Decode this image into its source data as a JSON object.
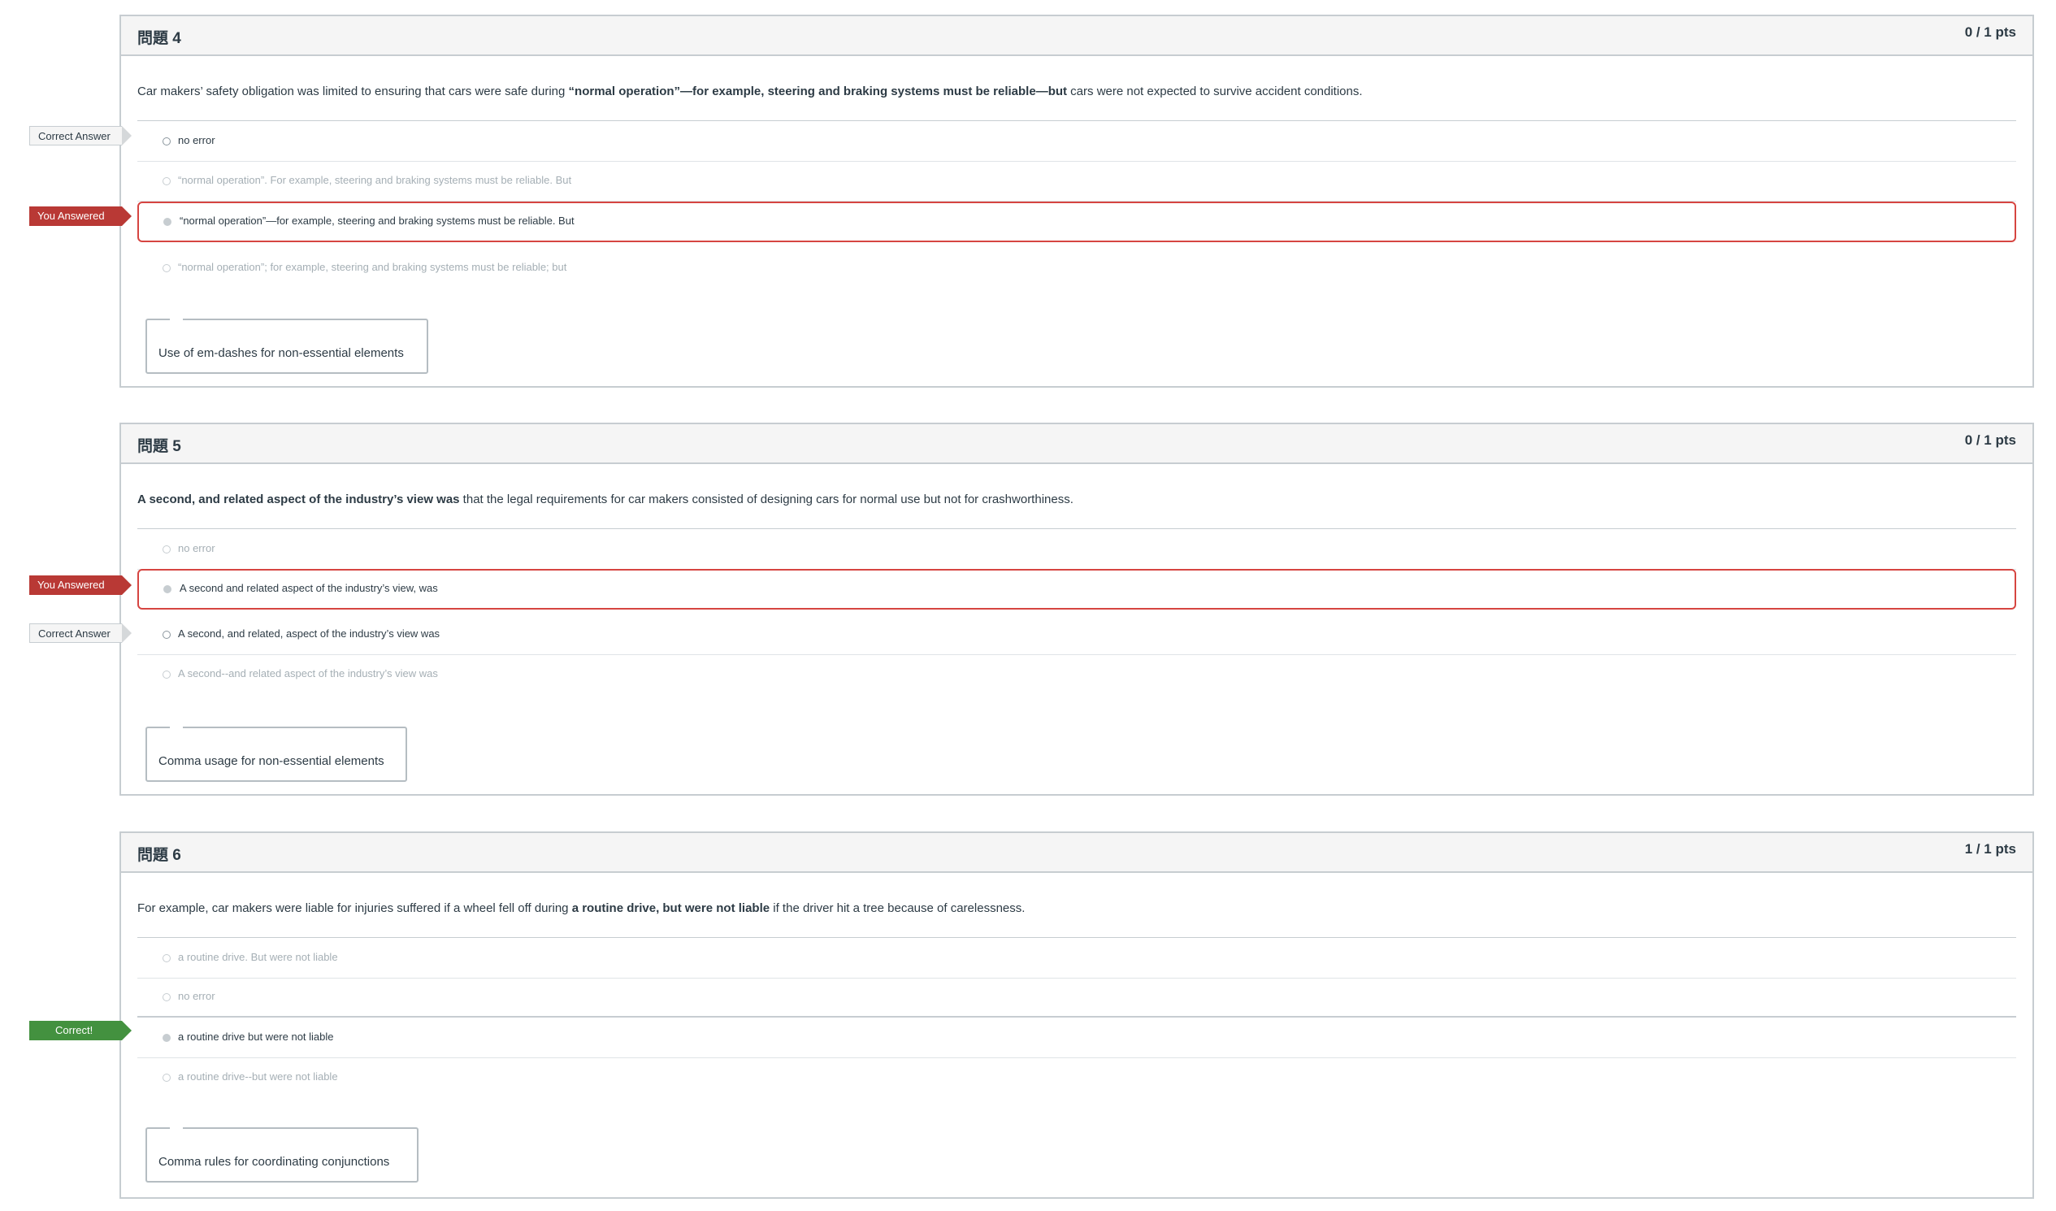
{
  "questions": [
    {
      "title": "問題 4",
      "points": "0 / 1 pts",
      "text_before": "Car makers’ safety obligation was limited to ensuring that cars were safe during ",
      "text_bold": "“normal operation”—for example, steering and braking systems must be reliable—but",
      "text_after": " cars were not expected to survive accident conditions.",
      "answers": [
        {
          "label": "no error",
          "state": "correct"
        },
        {
          "label": "“normal operation”. For example, steering and braking systems must be reliable. But",
          "state": "faded"
        },
        {
          "label": "“normal operation”—for example, steering and braking systems must be reliable. But",
          "state": "selected"
        },
        {
          "label": "“normal operation”; for example, steering and braking systems must be reliable; but",
          "state": "faded"
        }
      ],
      "comment": "Use of em-dashes for non-essential elements"
    },
    {
      "title": "問題 5",
      "points": "0 / 1 pts",
      "text_before": "",
      "text_bold": "A second, and related aspect of the industry’s view was",
      "text_after": " that the legal requirements for car makers consisted of designing cars for normal use but not for crashworthiness.",
      "answers": [
        {
          "label": "no error",
          "state": "faded"
        },
        {
          "label": "A second and related aspect of the industry’s view, was",
          "state": "selected"
        },
        {
          "label": "A second, and related, aspect of the industry’s view was",
          "state": "correct"
        },
        {
          "label": "A second--and related aspect of the industry’s view was",
          "state": "faded"
        }
      ],
      "comment": "Comma usage for non-essential elements"
    },
    {
      "title": "問題 6",
      "points": "1 / 1 pts",
      "text_before": "For example, car makers were liable for injuries suffered if a wheel fell off during ",
      "text_bold": "a routine drive, but were not liable",
      "text_after": " if the driver hit a tree because of carelessness.",
      "answers": [
        {
          "label": "a routine drive. But were not liable",
          "state": "faded"
        },
        {
          "label": "no error",
          "state": "faded"
        },
        {
          "label": "a routine drive but were not liable",
          "state": "chosen-correct"
        },
        {
          "label": "a routine drive--but were not liable",
          "state": "faded"
        }
      ],
      "comment": "Comma rules for coordinating conjunctions"
    }
  ],
  "tags": {
    "correct_answer": "Correct Answer",
    "you_answered": "You Answered",
    "correct": "Correct!"
  },
  "colors": {
    "selected_border": "#d64541",
    "you_answered_bg": "#b93935",
    "correct_bg": "#43913f",
    "border": "#c7cdd1"
  }
}
